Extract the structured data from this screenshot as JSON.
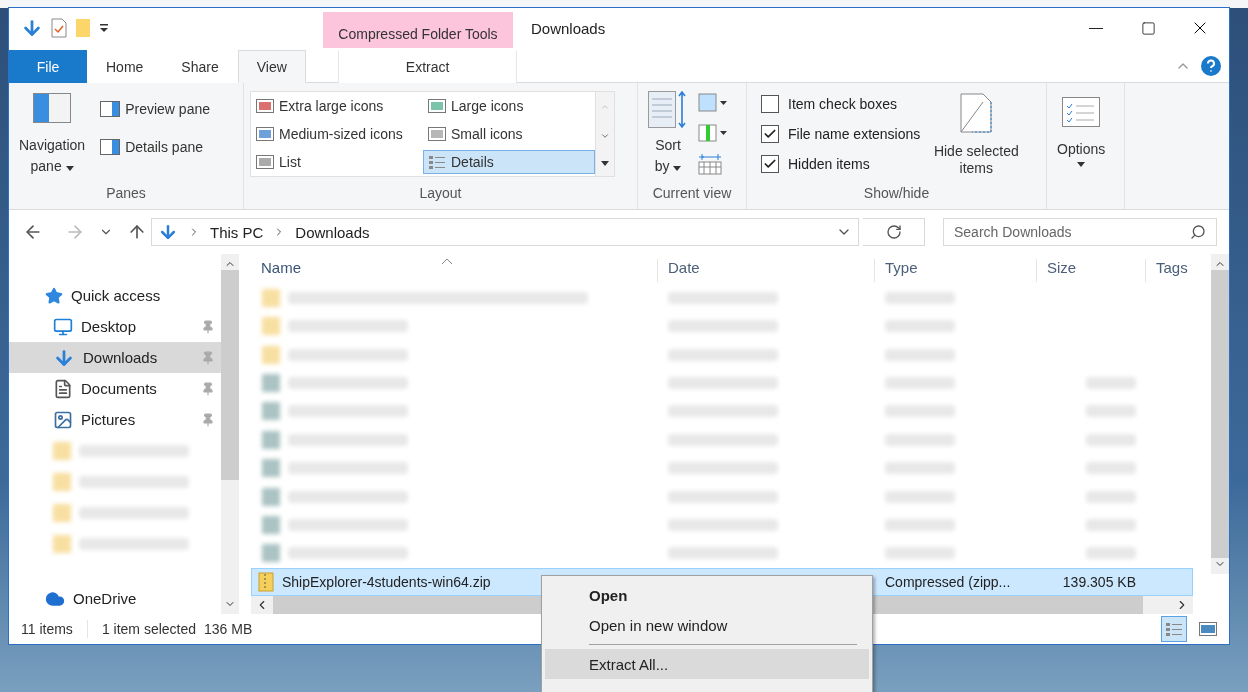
{
  "window": {
    "title": "Downloads",
    "contextual_group": "Compressed Folder Tools"
  },
  "ribbon_tabs": [
    {
      "label": "File",
      "kind": "file",
      "selected": false
    },
    {
      "label": "Home",
      "kind": "tab",
      "selected": false
    },
    {
      "label": "Share",
      "kind": "tab",
      "selected": false
    },
    {
      "label": "View",
      "kind": "tab",
      "selected": true
    },
    {
      "label": "Extract",
      "kind": "contextual",
      "selected": false
    }
  ],
  "ribbon": {
    "panes": {
      "label": "Panes",
      "navigation_pane": "Navigation pane",
      "items": [
        "Preview pane",
        "Details pane"
      ]
    },
    "layout": {
      "label": "Layout",
      "options": [
        {
          "label": "Extra large icons",
          "selected": false
        },
        {
          "label": "Large icons",
          "selected": false
        },
        {
          "label": "Medium-sized icons",
          "selected": false
        },
        {
          "label": "Small icons",
          "selected": false
        },
        {
          "label": "List",
          "selected": false
        },
        {
          "label": "Details",
          "selected": true
        }
      ]
    },
    "current_view": {
      "label": "Current view",
      "sort_by": "Sort by"
    },
    "show_hide": {
      "label": "Show/hide",
      "checkboxes": [
        {
          "label": "Item check boxes",
          "checked": false
        },
        {
          "label": "File name extensions",
          "checked": true
        },
        {
          "label": "Hidden items",
          "checked": true
        }
      ],
      "hide_selected": "Hide selected items"
    },
    "options": {
      "label": "Options"
    }
  },
  "address": {
    "path": [
      "This PC",
      "Downloads"
    ]
  },
  "search": {
    "placeholder": "Search Downloads"
  },
  "navigation": [
    {
      "kind": "quick-access",
      "label": "Quick access",
      "selected": false
    },
    {
      "kind": "desktop",
      "label": "Desktop",
      "selected": false
    },
    {
      "kind": "downloads",
      "label": "Downloads",
      "selected": true
    },
    {
      "kind": "documents",
      "label": "Documents",
      "selected": false
    },
    {
      "kind": "pictures",
      "label": "Pictures",
      "selected": false
    },
    {
      "kind": "blurred",
      "selected": false
    },
    {
      "kind": "blurred",
      "selected": false
    },
    {
      "kind": "blurred",
      "selected": false
    },
    {
      "kind": "blurred",
      "selected": false
    },
    {
      "kind": "onedrive",
      "label": "OneDrive",
      "selected": false
    }
  ],
  "table": {
    "columns": [
      {
        "label": "Name",
        "sorted": true
      },
      {
        "label": "Date",
        "sorted": false
      },
      {
        "label": "Type",
        "sorted": false
      },
      {
        "label": "Size",
        "sorted": false
      },
      {
        "label": "Tags",
        "sorted": false
      }
    ],
    "rows": [
      {
        "kind": "blurred",
        "selected": false
      },
      {
        "kind": "blurred",
        "selected": false
      },
      {
        "kind": "blurred",
        "selected": false
      },
      {
        "kind": "blurred",
        "selected": false
      },
      {
        "kind": "blurred",
        "selected": false
      },
      {
        "kind": "blurred",
        "selected": false
      },
      {
        "kind": "blurred",
        "selected": false
      },
      {
        "kind": "blurred",
        "selected": false
      },
      {
        "kind": "blurred",
        "selected": false
      },
      {
        "kind": "blurred",
        "selected": false
      },
      {
        "kind": "zip",
        "name": "ShipExplorer-4students-win64.zip",
        "type": "Compressed (zipp...",
        "size": "139.305 KB",
        "selected": true
      }
    ]
  },
  "status_bar": {
    "count": "11 items",
    "selection": "1 item selected",
    "size": "136 MB"
  },
  "context_menu": [
    {
      "kind": "default",
      "label": "Open",
      "selected": false
    },
    {
      "kind": "item",
      "label": "Open in new window",
      "selected": false
    },
    {
      "kind": "separator"
    },
    {
      "kind": "item",
      "label": "Extract All...",
      "selected": true
    }
  ]
}
